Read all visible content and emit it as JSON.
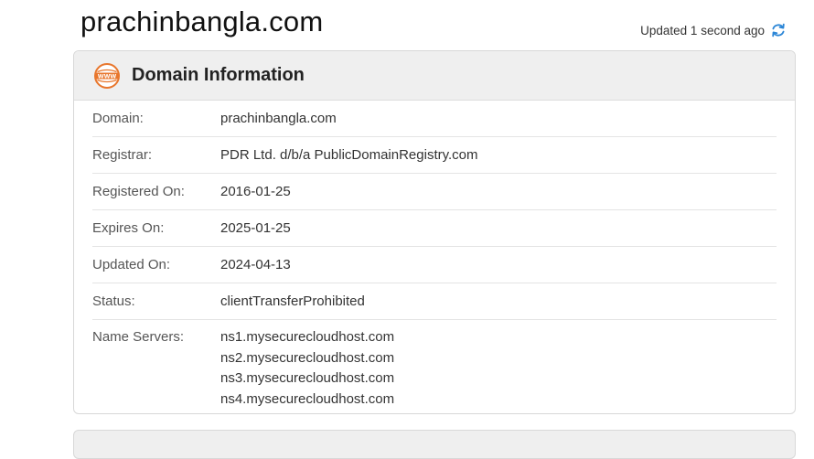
{
  "site": {
    "title": "prachinbangla.com"
  },
  "status_bar": {
    "updated_text": "Updated 1 second ago"
  },
  "icons": {
    "refresh": "refresh-icon",
    "www": "www-icon",
    "accent": "#e8762c",
    "refresh_color": "#2a85d6"
  },
  "domain_info": {
    "title": "Domain Information",
    "rows": [
      {
        "label": "Domain:",
        "value": "prachinbangla.com"
      },
      {
        "label": "Registrar:",
        "value": "PDR Ltd. d/b/a PublicDomainRegistry.com"
      },
      {
        "label": "Registered On:",
        "value": "2016-01-25"
      },
      {
        "label": "Expires On:",
        "value": "2025-01-25"
      },
      {
        "label": "Updated On:",
        "value": "2024-04-13"
      },
      {
        "label": "Status:",
        "value": "clientTransferProhibited"
      }
    ],
    "name_servers": {
      "label": "Name Servers:",
      "values": [
        "ns1.mysecurecloudhost.com",
        "ns2.mysecurecloudhost.com",
        "ns3.mysecurecloudhost.com",
        "ns4.mysecurecloudhost.com"
      ]
    }
  }
}
